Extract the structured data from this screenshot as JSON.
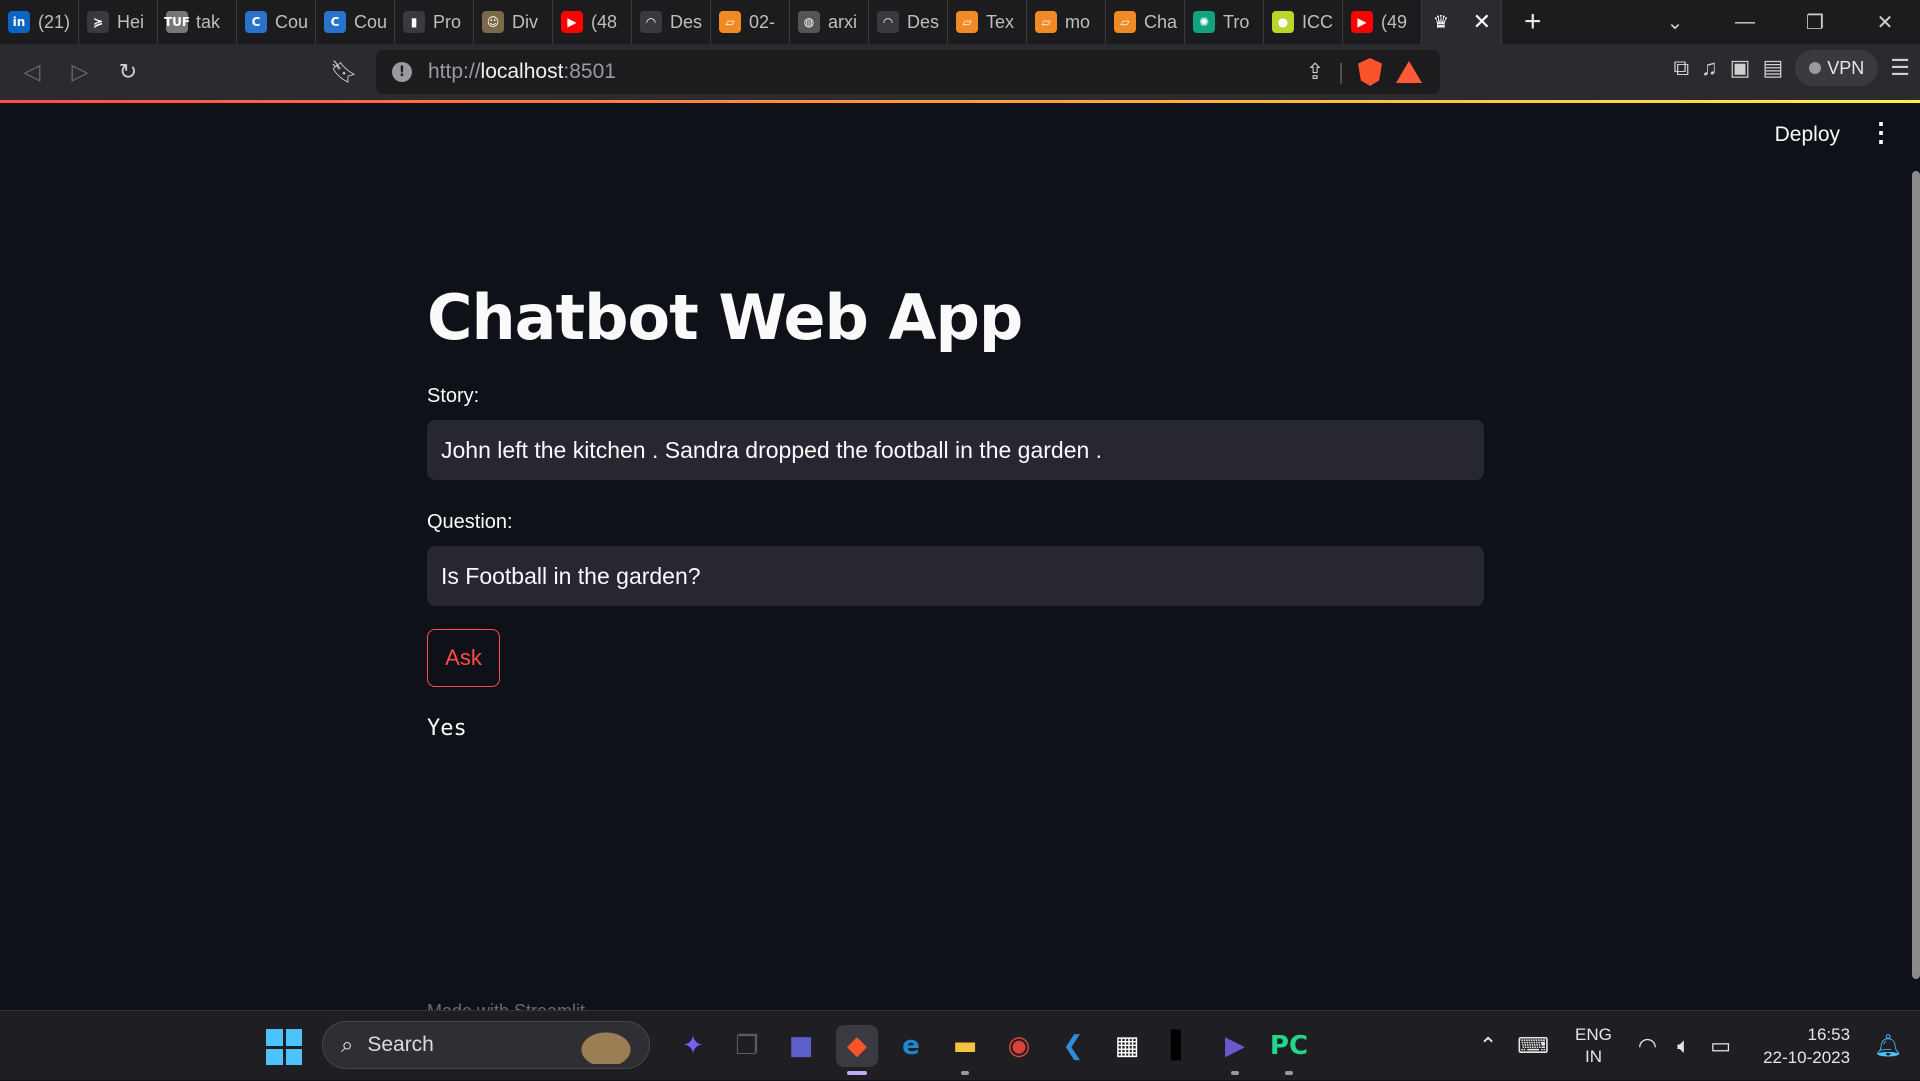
{
  "browser": {
    "tabs": [
      {
        "icon": "linkedin-icon",
        "label": "(21)",
        "color": "#0a66c2",
        "glyph": "in"
      },
      {
        "icon": "hero-icon",
        "label": "Hei",
        "color": "#3a3a3e",
        "glyph": "≽"
      },
      {
        "icon": "tuf-icon",
        "label": "tak",
        "color": "#777777",
        "glyph": "TUF"
      },
      {
        "icon": "coursera-icon",
        "label": "Cou",
        "color": "#2a73cc",
        "glyph": "C"
      },
      {
        "icon": "coursera-icon",
        "label": "Cou",
        "color": "#2a73cc",
        "glyph": "C"
      },
      {
        "icon": "chart-icon",
        "label": "Pro",
        "color": "#3a3a3e",
        "glyph": "▮"
      },
      {
        "icon": "person-icon",
        "label": "Div",
        "color": "#7a6a4a",
        "glyph": "☺"
      },
      {
        "icon": "youtube-icon",
        "label": "(48",
        "color": "#ff0000",
        "glyph": "▶"
      },
      {
        "icon": "arc-icon",
        "label": "Des",
        "color": "#3a3a3e",
        "glyph": "◠"
      },
      {
        "icon": "book-icon",
        "label": "02-",
        "color": "#f08a24",
        "glyph": "▱"
      },
      {
        "icon": "globe-icon",
        "label": "arxi",
        "color": "#555555",
        "glyph": "◍"
      },
      {
        "icon": "arc-icon",
        "label": "Des",
        "color": "#3a3a3e",
        "glyph": "◠"
      },
      {
        "icon": "book-icon",
        "label": "Tex",
        "color": "#f08a24",
        "glyph": "▱"
      },
      {
        "icon": "book-icon",
        "label": "mo",
        "color": "#f08a24",
        "glyph": "▱"
      },
      {
        "icon": "book-icon",
        "label": "Cha",
        "color": "#f08a24",
        "glyph": "▱"
      },
      {
        "icon": "openai-icon",
        "label": "Tro",
        "color": "#10a37f",
        "glyph": "✺"
      },
      {
        "icon": "cricket-ball-icon",
        "label": "ICC",
        "color": "#b9d62b",
        "glyph": "●"
      },
      {
        "icon": "youtube-icon",
        "label": "(49",
        "color": "#ff0000",
        "glyph": "▶"
      }
    ],
    "active_tab_icon": "streamlit-crown-icon",
    "url_scheme": "http://",
    "url_host": "localhost",
    "url_port": ":8501",
    "shield_badge": "1",
    "vpn_label": "VPN"
  },
  "app": {
    "deploy_label": "Deploy",
    "title": "Chatbot Web App",
    "story_label": "Story:",
    "story_value": "John left the kitchen . Sandra dropped the football in the garden .",
    "question_label": "Question:",
    "question_value": "Is Football in the garden?",
    "ask_label": "Ask",
    "answer": "Yes",
    "footer": "Made with Streamlit",
    "accent": "#ff4b4b"
  },
  "taskbar": {
    "search_placeholder": "Search",
    "apps": [
      {
        "name": "copilot-icon",
        "color": "#7a5cff",
        "glyph": "✦"
      },
      {
        "name": "task-view-icon",
        "color": "#5a5a60",
        "glyph": "❐"
      },
      {
        "name": "teams-chat-icon",
        "color": "#5b5fc7",
        "glyph": "■"
      },
      {
        "name": "brave-browser-icon",
        "color": "#fb542b",
        "glyph": "◆",
        "active": true
      },
      {
        "name": "edge-icon",
        "color": "#1a8ad4",
        "glyph": "e"
      },
      {
        "name": "file-explorer-icon",
        "color": "#f5c242",
        "glyph": "▬"
      },
      {
        "name": "chrome-icon",
        "color": "#db4437",
        "glyph": "◉"
      },
      {
        "name": "vscode-icon",
        "color": "#2c8dd6",
        "glyph": "❮"
      },
      {
        "name": "ms-store-icon",
        "color": "#ffffff",
        "glyph": "▦"
      },
      {
        "name": "audio-bars-icon",
        "color": "#000000",
        "glyph": "▌"
      },
      {
        "name": "media-player-icon",
        "color": "#6a5acd",
        "glyph": "▶"
      },
      {
        "name": "pycharm-icon",
        "color": "#21d789",
        "glyph": "PC"
      }
    ],
    "language_top": "ENG",
    "language_bottom": "IN",
    "time": "16:53",
    "date": "22-10-2023"
  }
}
